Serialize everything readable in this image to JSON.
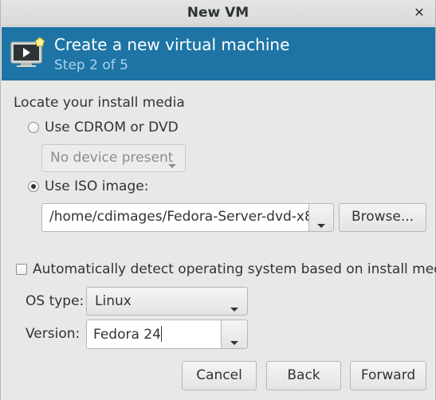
{
  "window": {
    "title": "New VM",
    "close_icon": "close-icon"
  },
  "banner": {
    "title": "Create a new virtual machine",
    "step": "Step 2 of 5",
    "icon": "virtual-machine-icon"
  },
  "install_media": {
    "heading": "Locate your install media",
    "cdrom_option": {
      "label": "Use CDROM or DVD",
      "selected": false
    },
    "cdrom_device": {
      "value": "No device present",
      "enabled": false
    },
    "iso_option": {
      "label": "Use ISO image:",
      "selected": true
    },
    "iso_path": {
      "value": "/home/cdimages/Fedora-Server-dvd-x8"
    },
    "browse_button": "Browse..."
  },
  "os_detect": {
    "label": "Automatically detect operating system based on install media",
    "checked": false
  },
  "os_type": {
    "label": "OS type:",
    "value": "Linux"
  },
  "version": {
    "label": "Version:",
    "value": "Fedora 24"
  },
  "buttons": {
    "cancel": "Cancel",
    "back": "Back",
    "forward": "Forward"
  }
}
